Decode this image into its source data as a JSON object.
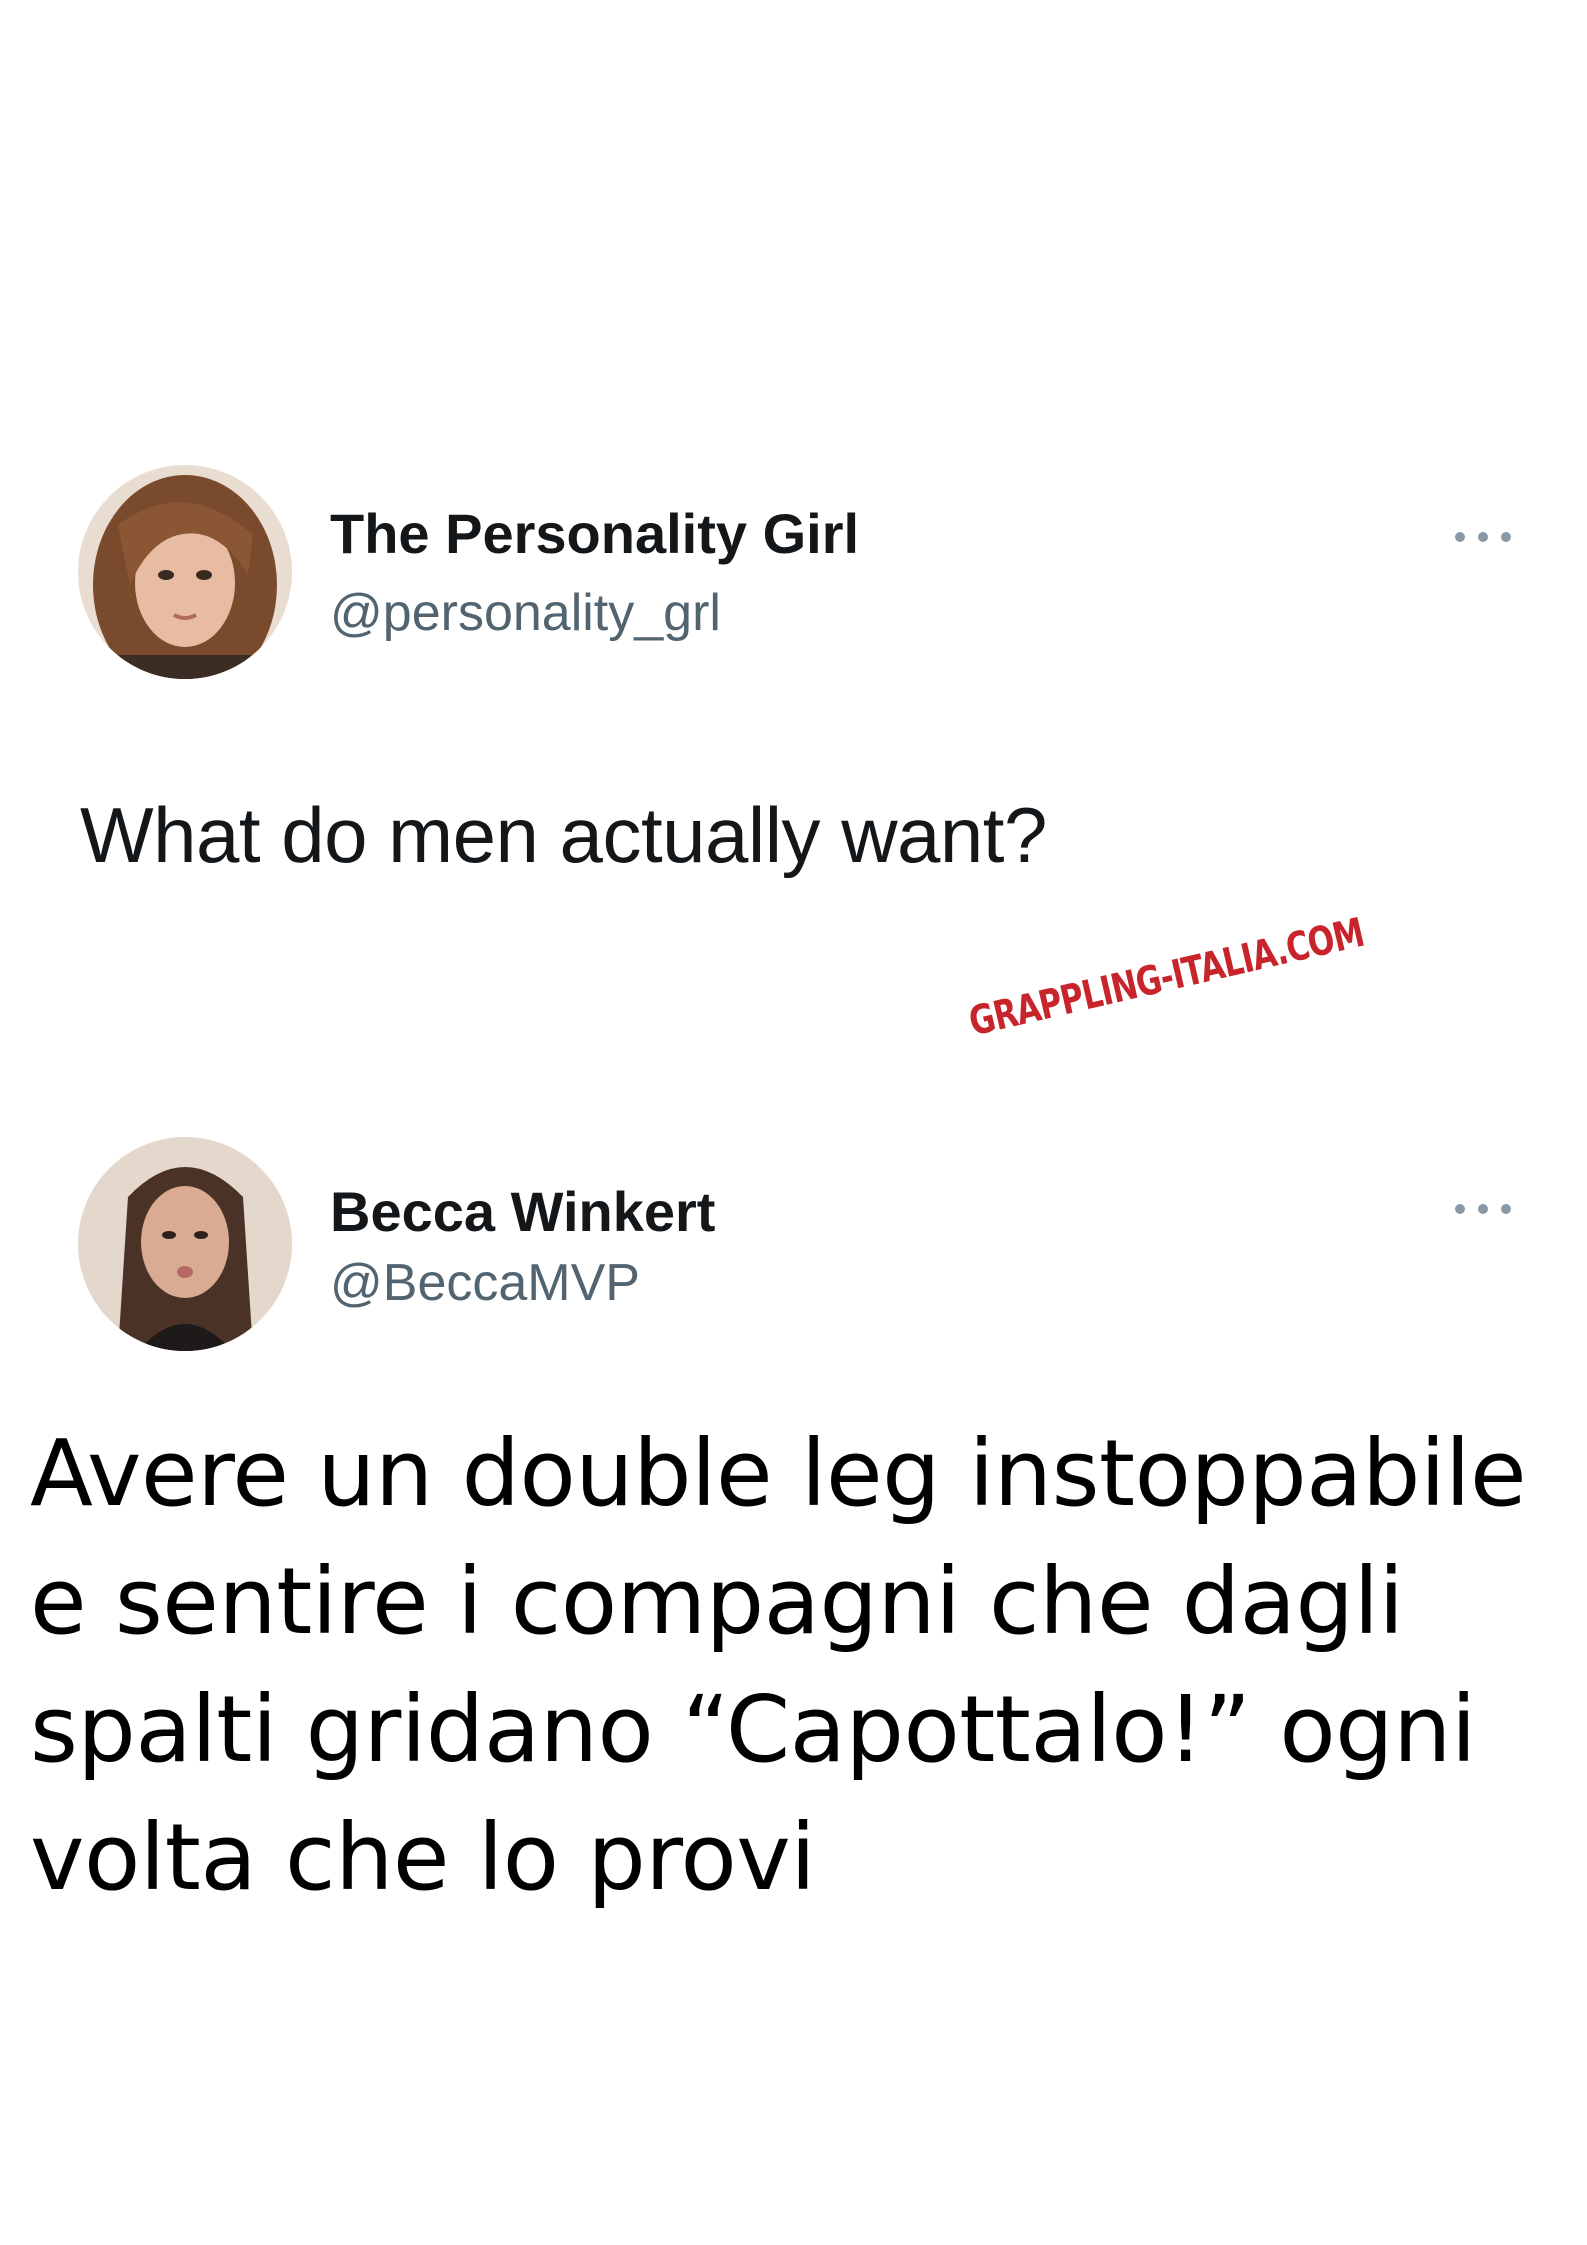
{
  "tweet1": {
    "author_name": "The Personality Girl",
    "author_handle": "@personality_grl",
    "text": "What do men actually want?",
    "avatar_icon": "user-avatar-photo",
    "more_icon": "more-options-icon"
  },
  "watermark": {
    "text": "GRAPPLING-ITALIA.COM",
    "color": "#c8242b"
  },
  "tweet2": {
    "author_name": "Becca Winkert",
    "author_handle": "@BeccaMVP",
    "avatar_icon": "user-avatar-photo",
    "more_icon": "more-options-icon",
    "text_lines": [
      "Avere un double leg instoppabile",
      "e sentire i compagni che dagli",
      "spalti gridano “Capottalo!” ogni",
      "volta che lo provi"
    ]
  },
  "colors": {
    "name": "#14171a",
    "handle": "#536471",
    "background": "#ffffff"
  }
}
